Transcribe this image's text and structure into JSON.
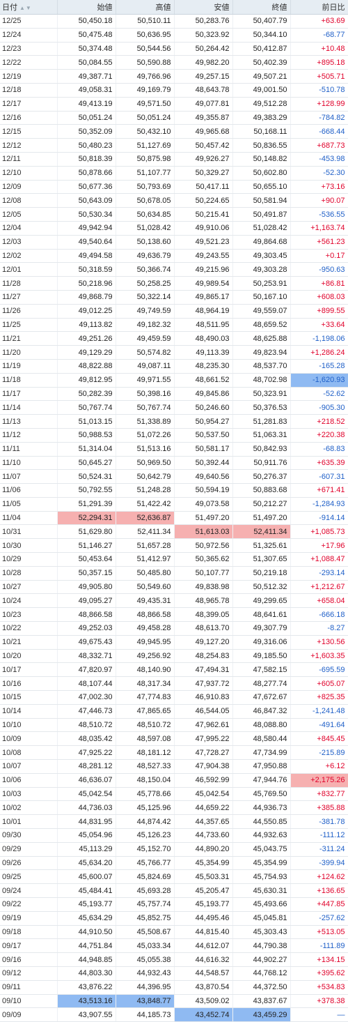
{
  "headers": [
    "日付",
    "始値",
    "高値",
    "安値",
    "終値",
    "前日比"
  ],
  "sort_icon": "sort-up-down-icon",
  "colors": {
    "positive": "#e0002a",
    "negative": "#2060c8",
    "highlight_high": "#f6b0b0",
    "highlight_low": "#8fbaf2"
  },
  "rows": [
    {
      "date": "12/25",
      "open": "50,450.18",
      "high": "50,510.11",
      "low": "50,283.76",
      "close": "50,407.79",
      "change": "+63.69"
    },
    {
      "date": "12/24",
      "open": "50,475.48",
      "high": "50,636.95",
      "low": "50,323.92",
      "close": "50,344.10",
      "change": "-68.77"
    },
    {
      "date": "12/23",
      "open": "50,374.48",
      "high": "50,544.56",
      "low": "50,264.42",
      "close": "50,412.87",
      "change": "+10.48"
    },
    {
      "date": "12/22",
      "open": "50,084.55",
      "high": "50,590.88",
      "low": "49,982.20",
      "close": "50,402.39",
      "change": "+895.18"
    },
    {
      "date": "12/19",
      "open": "49,387.71",
      "high": "49,766.96",
      "low": "49,257.15",
      "close": "49,507.21",
      "change": "+505.71"
    },
    {
      "date": "12/18",
      "open": "49,058.31",
      "high": "49,169.79",
      "low": "48,643.78",
      "close": "49,001.50",
      "change": "-510.78"
    },
    {
      "date": "12/17",
      "open": "49,413.19",
      "high": "49,571.50",
      "low": "49,077.81",
      "close": "49,512.28",
      "change": "+128.99"
    },
    {
      "date": "12/16",
      "open": "50,051.24",
      "high": "50,051.24",
      "low": "49,355.87",
      "close": "49,383.29",
      "change": "-784.82"
    },
    {
      "date": "12/15",
      "open": "50,352.09",
      "high": "50,432.10",
      "low": "49,965.68",
      "close": "50,168.11",
      "change": "-668.44"
    },
    {
      "date": "12/12",
      "open": "50,480.23",
      "high": "51,127.69",
      "low": "50,457.42",
      "close": "50,836.55",
      "change": "+687.73"
    },
    {
      "date": "12/11",
      "open": "50,818.39",
      "high": "50,875.98",
      "low": "49,926.27",
      "close": "50,148.82",
      "change": "-453.98"
    },
    {
      "date": "12/10",
      "open": "50,878.66",
      "high": "51,107.77",
      "low": "50,329.27",
      "close": "50,602.80",
      "change": "-52.30"
    },
    {
      "date": "12/09",
      "open": "50,677.36",
      "high": "50,793.69",
      "low": "50,417.11",
      "close": "50,655.10",
      "change": "+73.16"
    },
    {
      "date": "12/08",
      "open": "50,643.09",
      "high": "50,678.05",
      "low": "50,224.65",
      "close": "50,581.94",
      "change": "+90.07"
    },
    {
      "date": "12/05",
      "open": "50,530.34",
      "high": "50,634.85",
      "low": "50,215.41",
      "close": "50,491.87",
      "change": "-536.55"
    },
    {
      "date": "12/04",
      "open": "49,942.94",
      "high": "51,028.42",
      "low": "49,910.06",
      "close": "51,028.42",
      "change": "+1,163.74"
    },
    {
      "date": "12/03",
      "open": "49,540.64",
      "high": "50,138.60",
      "low": "49,521.23",
      "close": "49,864.68",
      "change": "+561.23"
    },
    {
      "date": "12/02",
      "open": "49,494.58",
      "high": "49,636.79",
      "low": "49,243.55",
      "close": "49,303.45",
      "change": "+0.17"
    },
    {
      "date": "12/01",
      "open": "50,318.59",
      "high": "50,366.74",
      "low": "49,215.96",
      "close": "49,303.28",
      "change": "-950.63"
    },
    {
      "date": "11/28",
      "open": "50,218.96",
      "high": "50,258.25",
      "low": "49,989.54",
      "close": "50,253.91",
      "change": "+86.81"
    },
    {
      "date": "11/27",
      "open": "49,868.79",
      "high": "50,322.14",
      "low": "49,865.17",
      "close": "50,167.10",
      "change": "+608.03"
    },
    {
      "date": "11/26",
      "open": "49,012.25",
      "high": "49,749.59",
      "low": "48,964.19",
      "close": "49,559.07",
      "change": "+899.55"
    },
    {
      "date": "11/25",
      "open": "49,113.82",
      "high": "49,182.32",
      "low": "48,511.95",
      "close": "48,659.52",
      "change": "+33.64"
    },
    {
      "date": "11/21",
      "open": "49,251.26",
      "high": "49,459.59",
      "low": "48,490.03",
      "close": "48,625.88",
      "change": "-1,198.06"
    },
    {
      "date": "11/20",
      "open": "49,129.29",
      "high": "50,574.82",
      "low": "49,113.39",
      "close": "49,823.94",
      "change": "+1,286.24"
    },
    {
      "date": "11/19",
      "open": "48,822.88",
      "high": "49,087.11",
      "low": "48,235.30",
      "close": "48,537.70",
      "change": "-165.28"
    },
    {
      "date": "11/18",
      "open": "49,812.95",
      "high": "49,971.55",
      "low": "48,661.52",
      "close": "48,702.98",
      "change": "-1,620.93",
      "hl": {
        "change": "blue"
      }
    },
    {
      "date": "11/17",
      "open": "50,282.39",
      "high": "50,398.16",
      "low": "49,845.86",
      "close": "50,323.91",
      "change": "-52.62"
    },
    {
      "date": "11/14",
      "open": "50,767.74",
      "high": "50,767.74",
      "low": "50,246.60",
      "close": "50,376.53",
      "change": "-905.30"
    },
    {
      "date": "11/13",
      "open": "51,013.15",
      "high": "51,338.89",
      "low": "50,954.27",
      "close": "51,281.83",
      "change": "+218.52"
    },
    {
      "date": "11/12",
      "open": "50,988.53",
      "high": "51,072.26",
      "low": "50,537.50",
      "close": "51,063.31",
      "change": "+220.38"
    },
    {
      "date": "11/11",
      "open": "51,314.04",
      "high": "51,513.16",
      "low": "50,581.17",
      "close": "50,842.93",
      "change": "-68.83"
    },
    {
      "date": "11/10",
      "open": "50,645.27",
      "high": "50,969.50",
      "low": "50,392.44",
      "close": "50,911.76",
      "change": "+635.39"
    },
    {
      "date": "11/07",
      "open": "50,524.31",
      "high": "50,642.79",
      "low": "49,640.56",
      "close": "50,276.37",
      "change": "-607.31"
    },
    {
      "date": "11/06",
      "open": "50,792.55",
      "high": "51,248.28",
      "low": "50,594.19",
      "close": "50,883.68",
      "change": "+671.41"
    },
    {
      "date": "11/05",
      "open": "51,291.39",
      "high": "51,422.42",
      "low": "49,073.58",
      "close": "50,212.27",
      "change": "-1,284.93"
    },
    {
      "date": "11/04",
      "open": "52,294.31",
      "high": "52,636.87",
      "low": "51,497.20",
      "close": "51,497.20",
      "change": "-914.14",
      "hl": {
        "open": "red",
        "high": "red"
      }
    },
    {
      "date": "10/31",
      "open": "51,629.80",
      "high": "52,411.34",
      "low": "51,613.03",
      "close": "52,411.34",
      "change": "+1,085.73",
      "hl": {
        "low": "red",
        "close": "red"
      }
    },
    {
      "date": "10/30",
      "open": "51,146.27",
      "high": "51,657.28",
      "low": "50,972.56",
      "close": "51,325.61",
      "change": "+17.96"
    },
    {
      "date": "10/29",
      "open": "50,453.64",
      "high": "51,412.97",
      "low": "50,365.62",
      "close": "51,307.65",
      "change": "+1,088.47"
    },
    {
      "date": "10/28",
      "open": "50,357.15",
      "high": "50,485.80",
      "low": "50,107.77",
      "close": "50,219.18",
      "change": "-293.14"
    },
    {
      "date": "10/27",
      "open": "49,905.80",
      "high": "50,549.60",
      "low": "49,838.98",
      "close": "50,512.32",
      "change": "+1,212.67"
    },
    {
      "date": "10/24",
      "open": "49,095.27",
      "high": "49,435.31",
      "low": "48,965.78",
      "close": "49,299.65",
      "change": "+658.04"
    },
    {
      "date": "10/23",
      "open": "48,866.58",
      "high": "48,866.58",
      "low": "48,399.05",
      "close": "48,641.61",
      "change": "-666.18"
    },
    {
      "date": "10/22",
      "open": "49,252.03",
      "high": "49,458.28",
      "low": "48,613.70",
      "close": "49,307.79",
      "change": "-8.27"
    },
    {
      "date": "10/21",
      "open": "49,675.43",
      "high": "49,945.95",
      "low": "49,127.20",
      "close": "49,316.06",
      "change": "+130.56"
    },
    {
      "date": "10/20",
      "open": "48,332.71",
      "high": "49,256.92",
      "low": "48,254.83",
      "close": "49,185.50",
      "change": "+1,603.35"
    },
    {
      "date": "10/17",
      "open": "47,820.97",
      "high": "48,140.90",
      "low": "47,494.31",
      "close": "47,582.15",
      "change": "-695.59"
    },
    {
      "date": "10/16",
      "open": "48,107.44",
      "high": "48,317.34",
      "low": "47,937.72",
      "close": "48,277.74",
      "change": "+605.07"
    },
    {
      "date": "10/15",
      "open": "47,002.30",
      "high": "47,774.83",
      "low": "46,910.83",
      "close": "47,672.67",
      "change": "+825.35"
    },
    {
      "date": "10/14",
      "open": "47,446.73",
      "high": "47,865.65",
      "low": "46,544.05",
      "close": "46,847.32",
      "change": "-1,241.48"
    },
    {
      "date": "10/10",
      "open": "48,510.72",
      "high": "48,510.72",
      "low": "47,962.61",
      "close": "48,088.80",
      "change": "-491.64"
    },
    {
      "date": "10/09",
      "open": "48,035.42",
      "high": "48,597.08",
      "low": "47,995.22",
      "close": "48,580.44",
      "change": "+845.45"
    },
    {
      "date": "10/08",
      "open": "47,925.22",
      "high": "48,181.12",
      "low": "47,728.27",
      "close": "47,734.99",
      "change": "-215.89"
    },
    {
      "date": "10/07",
      "open": "48,281.12",
      "high": "48,527.33",
      "low": "47,904.38",
      "close": "47,950.88",
      "change": "+6.12"
    },
    {
      "date": "10/06",
      "open": "46,636.07",
      "high": "48,150.04",
      "low": "46,592.99",
      "close": "47,944.76",
      "change": "+2,175.26",
      "hl": {
        "change": "red"
      }
    },
    {
      "date": "10/03",
      "open": "45,042.54",
      "high": "45,778.66",
      "low": "45,042.54",
      "close": "45,769.50",
      "change": "+832.77"
    },
    {
      "date": "10/02",
      "open": "44,736.03",
      "high": "45,125.96",
      "low": "44,659.22",
      "close": "44,936.73",
      "change": "+385.88"
    },
    {
      "date": "10/01",
      "open": "44,831.95",
      "high": "44,874.42",
      "low": "44,357.65",
      "close": "44,550.85",
      "change": "-381.78"
    },
    {
      "date": "09/30",
      "open": "45,054.96",
      "high": "45,126.23",
      "low": "44,733.60",
      "close": "44,932.63",
      "change": "-111.12"
    },
    {
      "date": "09/29",
      "open": "45,113.29",
      "high": "45,152.70",
      "low": "44,890.20",
      "close": "45,043.75",
      "change": "-311.24"
    },
    {
      "date": "09/26",
      "open": "45,634.20",
      "high": "45,766.77",
      "low": "45,354.99",
      "close": "45,354.99",
      "change": "-399.94"
    },
    {
      "date": "09/25",
      "open": "45,600.07",
      "high": "45,824.69",
      "low": "45,503.31",
      "close": "45,754.93",
      "change": "+124.62"
    },
    {
      "date": "09/24",
      "open": "45,484.41",
      "high": "45,693.28",
      "low": "45,205.47",
      "close": "45,630.31",
      "change": "+136.65"
    },
    {
      "date": "09/22",
      "open": "45,193.77",
      "high": "45,757.74",
      "low": "45,193.77",
      "close": "45,493.66",
      "change": "+447.85"
    },
    {
      "date": "09/19",
      "open": "45,634.29",
      "high": "45,852.75",
      "low": "44,495.46",
      "close": "45,045.81",
      "change": "-257.62"
    },
    {
      "date": "09/18",
      "open": "44,910.50",
      "high": "45,508.67",
      "low": "44,815.40",
      "close": "45,303.43",
      "change": "+513.05"
    },
    {
      "date": "09/17",
      "open": "44,751.84",
      "high": "45,033.34",
      "low": "44,612.07",
      "close": "44,790.38",
      "change": "-111.89"
    },
    {
      "date": "09/16",
      "open": "44,948.85",
      "high": "45,055.38",
      "low": "44,616.32",
      "close": "44,902.27",
      "change": "+134.15"
    },
    {
      "date": "09/12",
      "open": "44,803.30",
      "high": "44,932.43",
      "low": "44,548.57",
      "close": "44,768.12",
      "change": "+395.62"
    },
    {
      "date": "09/11",
      "open": "43,876.22",
      "high": "44,396.95",
      "low": "43,870.54",
      "close": "44,372.50",
      "change": "+534.83"
    },
    {
      "date": "09/10",
      "open": "43,513.16",
      "high": "43,848.77",
      "low": "43,509.02",
      "close": "43,837.67",
      "change": "+378.38",
      "hl": {
        "open": "blue",
        "high": "blue"
      }
    },
    {
      "date": "09/09",
      "open": "43,907.55",
      "high": "44,185.73",
      "low": "43,452.74",
      "close": "43,459.29",
      "change": "—",
      "hl": {
        "low": "blue",
        "close": "blue"
      }
    }
  ]
}
